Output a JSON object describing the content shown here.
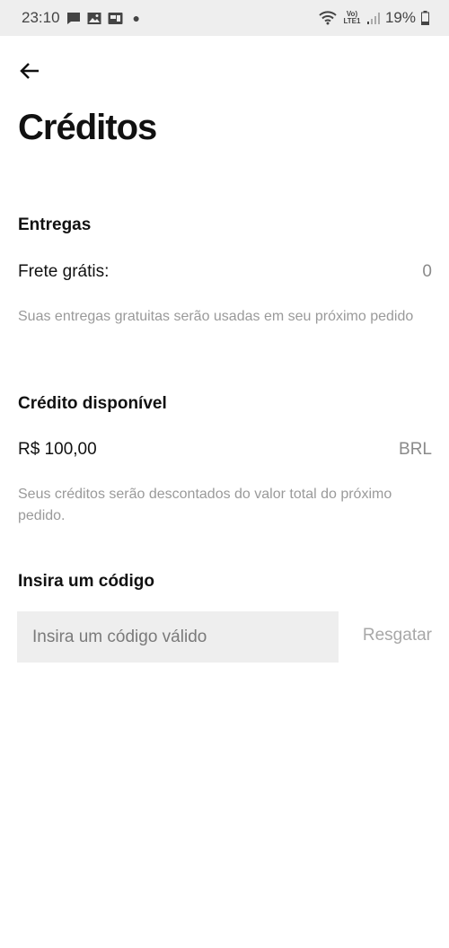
{
  "status_bar": {
    "time": "23:10",
    "network_label": "Vo) LTE1",
    "battery": "19%",
    "icons": [
      "message-icon",
      "image-icon",
      "gallery-icon",
      "dot-icon",
      "wifi-icon",
      "volte-icon",
      "signal-icon",
      "battery-icon"
    ]
  },
  "header": {
    "back_icon": "back-arrow-icon",
    "title": "Créditos"
  },
  "deliveries": {
    "heading": "Entregas",
    "label": "Frete grátis:",
    "value": "0",
    "note": "Suas entregas gratuitas serão usadas em seu próximo pedido"
  },
  "credit": {
    "heading": "Crédito disponível",
    "amount": "R$ 100,00",
    "currency": "BRL",
    "note": "Seus créditos serão descontados do valor total do próximo pedido."
  },
  "promo": {
    "heading": "Insira um código",
    "input_value": "",
    "placeholder": "Insira um código válido",
    "redeem_label": "Resgatar"
  }
}
